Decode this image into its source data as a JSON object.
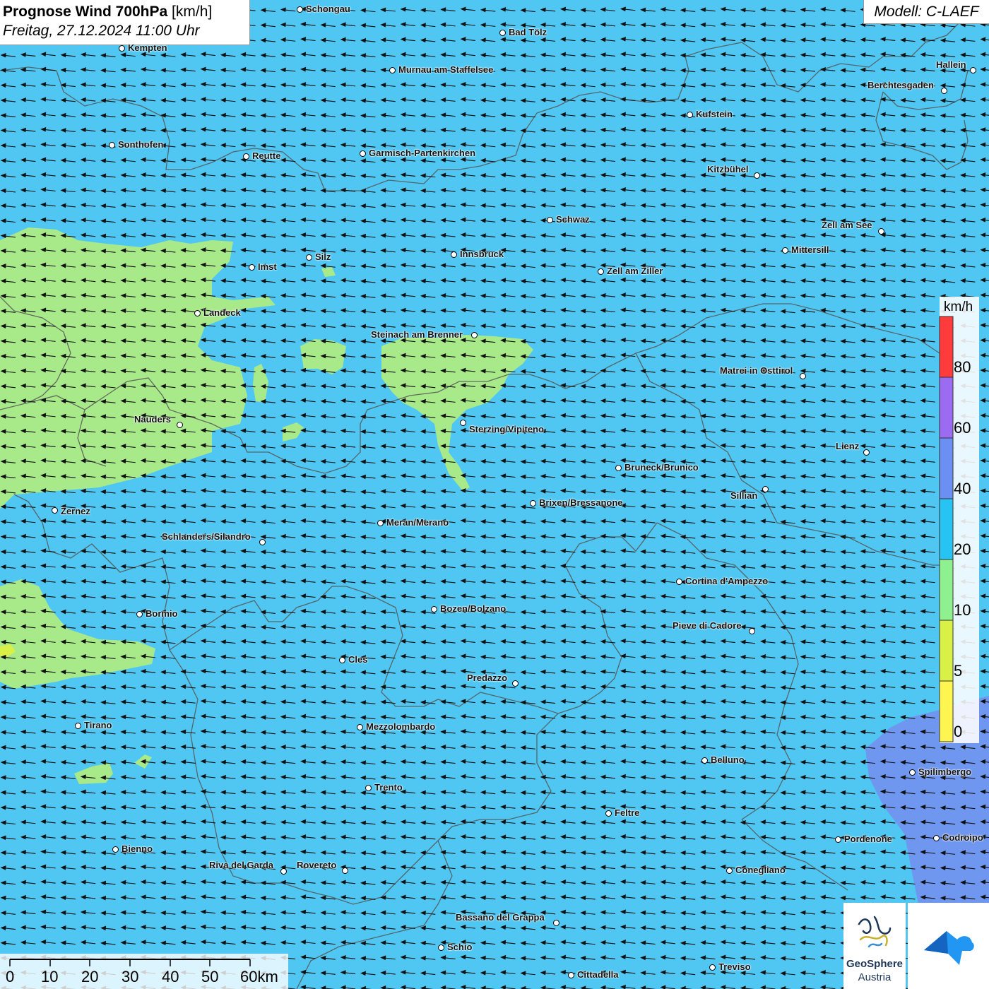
{
  "header": {
    "title_bold": "Prognose Wind 700hPa",
    "title_unit": "[km/h]",
    "datetime": "Freitag, 27.12.2024 11:00 Uhr",
    "model": "Modell: C-LAEF"
  },
  "legend": {
    "unit": "km/h",
    "labels": [
      "80",
      "60",
      "40",
      "20",
      "10",
      "5",
      "0"
    ],
    "colors": [
      "#ff3b3b",
      "#9b6bf2",
      "#6b8ff2",
      "#27c3f2",
      "#8ef08e",
      "#d9f046",
      "#fff550"
    ]
  },
  "scale_bar": {
    "labels": [
      "0",
      "10",
      "20",
      "30",
      "40",
      "50",
      "60km"
    ]
  },
  "logos": {
    "geosphere_line1": "GeoSphere",
    "geosphere_line2": "Austria"
  },
  "wind_direction": "from east (arrows pointing west)",
  "colors": {
    "ocean_blue": "#4fc7f2",
    "green_area": "#a8ea8a",
    "purple_area": "#6f97f0",
    "border": "#555555"
  },
  "cities": [
    {
      "name": "Schongau"
    },
    {
      "name": "Bad Tölz"
    },
    {
      "name": "Kempten"
    },
    {
      "name": "Murnau am Staffelsee"
    },
    {
      "name": "Hallein"
    },
    {
      "name": "Berchtesgaden"
    },
    {
      "name": "Kufstein"
    },
    {
      "name": "Sonthofen"
    },
    {
      "name": "Reutte"
    },
    {
      "name": "Garmisch-Partenkirchen"
    },
    {
      "name": "Kitzbühel"
    },
    {
      "name": "Schwaz"
    },
    {
      "name": "Zell am See"
    },
    {
      "name": "Innsbruck"
    },
    {
      "name": "Mittersill"
    },
    {
      "name": "Imst"
    },
    {
      "name": "Silz"
    },
    {
      "name": "Zell am Ziller"
    },
    {
      "name": "Landeck"
    },
    {
      "name": "Steinach am Brenner"
    },
    {
      "name": "Matrei in Osttirol"
    },
    {
      "name": "Nauders"
    },
    {
      "name": "Sterzing/Vipiteno"
    },
    {
      "name": "Lienz"
    },
    {
      "name": "Bruneck/Brunico"
    },
    {
      "name": "Sillian"
    },
    {
      "name": "Zernez"
    },
    {
      "name": "Brixen/Bressanone"
    },
    {
      "name": "Meran/Merano"
    },
    {
      "name": "Schlanders/Silandro"
    },
    {
      "name": "Cortina d'Ampezzo"
    },
    {
      "name": "Bozen/Bolzano"
    },
    {
      "name": "Bormio"
    },
    {
      "name": "Pieve di Cadore"
    },
    {
      "name": "Cles"
    },
    {
      "name": "Predazzo"
    },
    {
      "name": "Tirano"
    },
    {
      "name": "Mezzolombardo"
    },
    {
      "name": "Belluno"
    },
    {
      "name": "Spilimbergo"
    },
    {
      "name": "Trento"
    },
    {
      "name": "Feltre"
    },
    {
      "name": "Bienno"
    },
    {
      "name": "Pordenone"
    },
    {
      "name": "Codroipo"
    },
    {
      "name": "Riva del Garda"
    },
    {
      "name": "Rovereto"
    },
    {
      "name": "Conegliano"
    },
    {
      "name": "Bassano del Grappa"
    },
    {
      "name": "Schio"
    },
    {
      "name": "Treviso"
    },
    {
      "name": "Cittadella"
    }
  ]
}
